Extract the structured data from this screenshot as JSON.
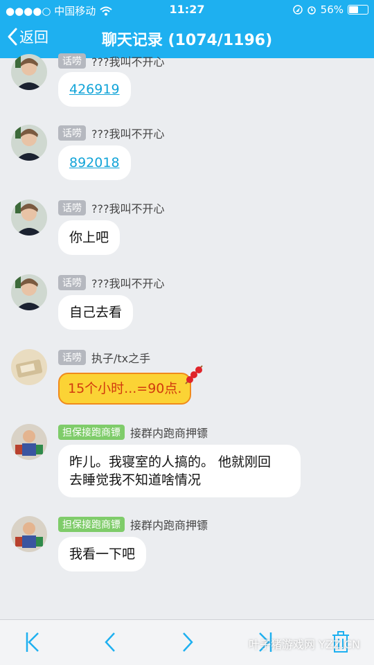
{
  "status_bar": {
    "carrier": "●●●●○ 中国移动",
    "time": "11:27",
    "battery_text": "56%",
    "battery_level": 0.56
  },
  "nav": {
    "back_label": "返回",
    "title": "聊天记录 (1074/1196)"
  },
  "messages": [
    {
      "badge": "话唠",
      "sender": "???我叫不开心",
      "text": "426919"
    },
    {
      "badge": "话唠",
      "sender": "???我叫不开心",
      "text": "892018"
    },
    {
      "badge": "话唠",
      "sender": "???我叫不开心",
      "text": "你上吧"
    },
    {
      "badge": "话唠",
      "sender": "???我叫不开心",
      "text": "自己去看"
    },
    {
      "badge": "话唠",
      "sender": "执子/tx之手",
      "text": "15个小时...=90点."
    },
    {
      "badge": "担保接跑商镖",
      "sender": "接群内跑商押镖",
      "text_line1": "昨儿。我寝室的人搞的。 他就刚回",
      "text_line2": "去睡觉我不知道啥情况"
    },
    {
      "badge": "担保接跑商镖",
      "sender": "接群内跑商押镖",
      "text": "我看一下吧"
    }
  ],
  "toolbar": {
    "icons": [
      "first-page-icon",
      "previous-page-icon",
      "next-page-icon",
      "last-page-icon",
      "trash-icon"
    ]
  },
  "watermark": "叶子猪游戏网 YZZ.CN",
  "colors": {
    "header": "#1eb0f0",
    "background": "#ebedf0",
    "link": "#12a4d8",
    "badge_gray": "#b5b8bf",
    "badge_green": "#7fcc6a",
    "highlight_bubble": "#fbd335"
  }
}
